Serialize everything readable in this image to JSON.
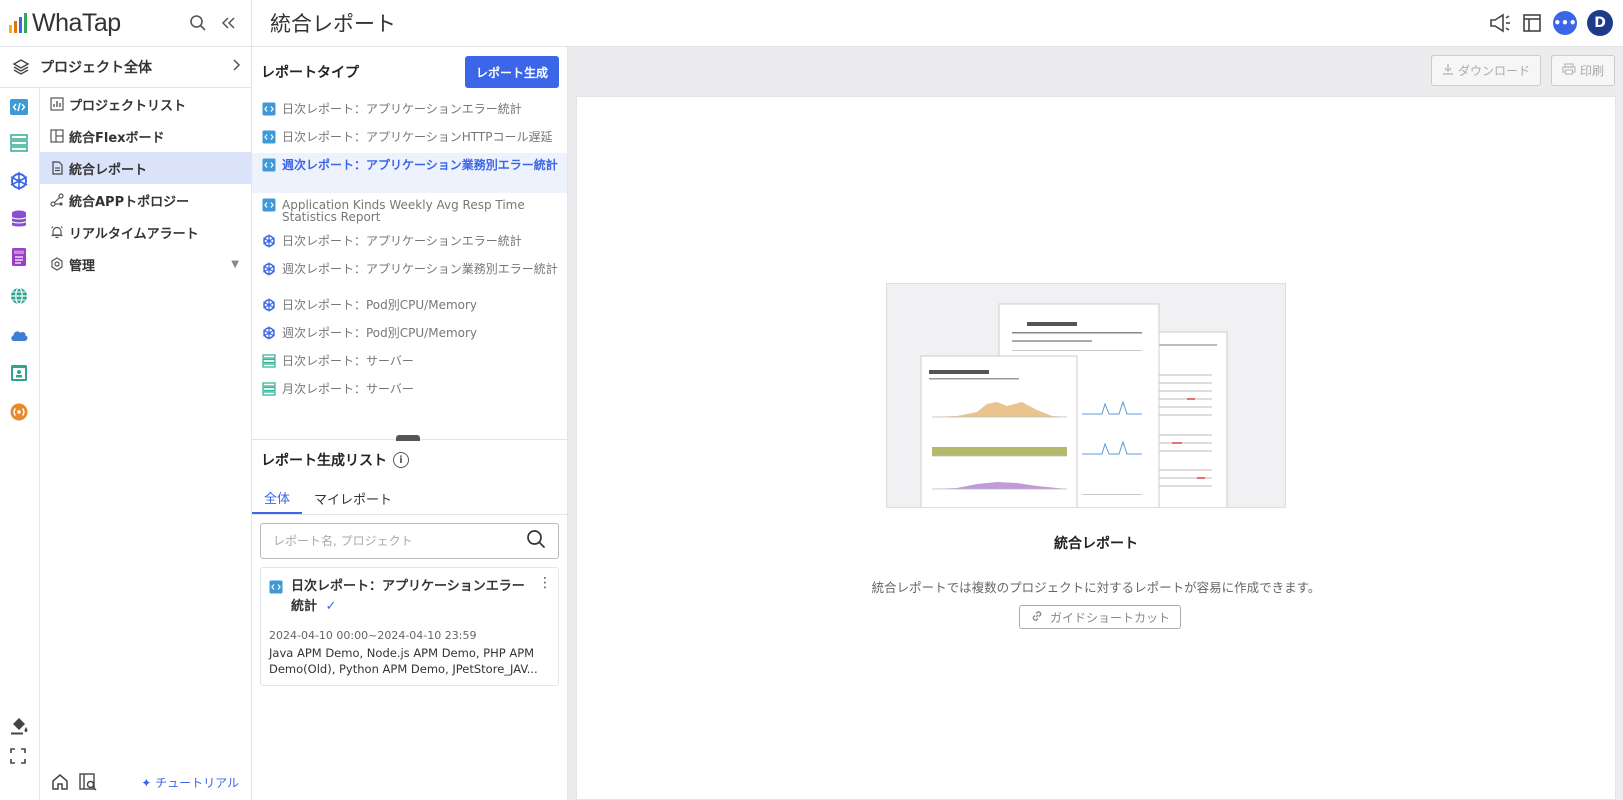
{
  "app": {
    "logo_text": "WhaTap"
  },
  "header": {
    "page_title": "統合レポート",
    "avatar_initial": "D"
  },
  "project_selector": {
    "label": "プロジェクト全体"
  },
  "nav": {
    "items": [
      {
        "label": "プロジェクトリスト",
        "icon": "bar-chart-icon"
      },
      {
        "label": "統合Flexボード",
        "icon": "layout-icon"
      },
      {
        "label": "統合レポート",
        "icon": "document-icon",
        "active": true
      },
      {
        "label": "統合APPトポロジー",
        "icon": "topology-icon"
      },
      {
        "label": "リアルタイムアラート",
        "icon": "alarm-icon"
      },
      {
        "label": "管理",
        "icon": "gear-icon"
      }
    ],
    "tutorial": "チュートリアル"
  },
  "report_types": {
    "title": "レポートタイプ",
    "generate_button": "レポート生成",
    "items": [
      {
        "label": "日次レポート：アプリケーションエラー統計",
        "icon": "app-code-icon"
      },
      {
        "label": "日次レポート：アプリケーションHTTPコール遅延",
        "icon": "app-code-icon"
      },
      {
        "label": "週次レポート：アプリケーション業務別エラー統計",
        "icon": "app-code-icon",
        "active": true
      },
      {
        "label": "Application Kinds Weekly Avg Resp Time Statistics Report",
        "icon": "app-code-icon"
      },
      {
        "label": "日次レポート：アプリケーションエラー統計",
        "icon": "kubernetes-icon"
      },
      {
        "label": "週次レポート：アプリケーション業務別エラー統計",
        "icon": "kubernetes-icon"
      },
      {
        "label": "日次レポート：Pod別CPU/Memory",
        "icon": "kubernetes-icon"
      },
      {
        "label": "週次レポート：Pod別CPU/Memory",
        "icon": "kubernetes-icon"
      },
      {
        "label": "日次レポート：サーバー",
        "icon": "server-icon"
      },
      {
        "label": "月次レポート：サーバー",
        "icon": "server-icon"
      }
    ]
  },
  "generated_list": {
    "title": "レポート生成リスト",
    "tabs": [
      "全体",
      "マイレポート"
    ],
    "search_placeholder": "レポート名, プロジェクト",
    "card": {
      "title": "日次レポート：アプリケーションエラー統計",
      "period": "2024-04-10 00:00~2024-04-10 23:59",
      "projects": "Java APM Demo, Node.js APM Demo, PHP APM Demo(Old), Python APM Demo, JPetStore_JAV..."
    }
  },
  "content": {
    "download_button": "ダウンロード",
    "print_button": "印刷",
    "empty_title": "統合レポート",
    "empty_description": "統合レポートでは複数のプロジェクトに対するレポートが容易に作成できます。",
    "guide_button": "ガイドショートカット"
  },
  "colors": {
    "accent": "#3b66e8",
    "active_bg": "#dbe3fb",
    "avatar": "#1e3a8a"
  }
}
